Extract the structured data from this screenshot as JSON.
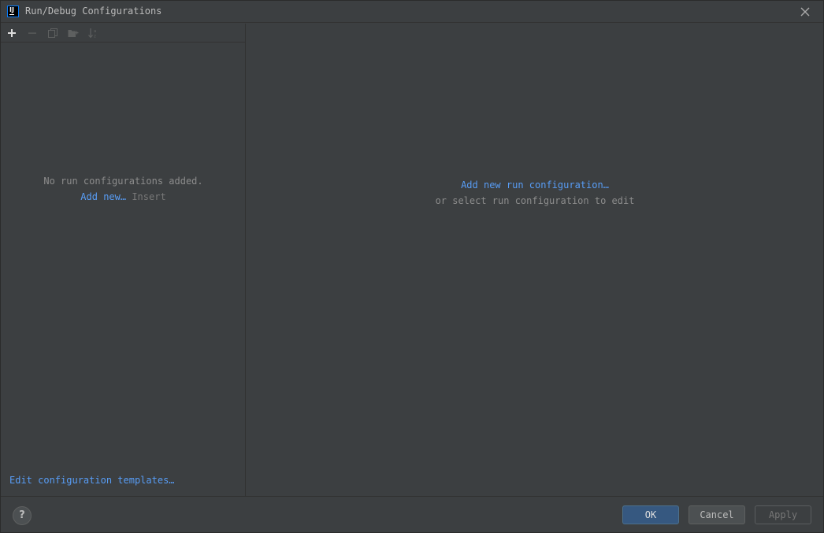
{
  "window": {
    "title": "Run/Debug Configurations",
    "app_icon_text": "IJ"
  },
  "toolbar": {
    "icons": [
      "add-icon",
      "remove-icon",
      "copy-icon",
      "folder-icon",
      "sort-icon"
    ]
  },
  "left_panel": {
    "empty_message": "No run configurations added.",
    "add_new_label": "Add new…",
    "insert_hint": "Insert",
    "templates_link": "Edit configuration templates…"
  },
  "right_panel": {
    "add_link": "Add new run configuration…",
    "subtitle": "or select run configuration to edit"
  },
  "footer": {
    "help_label": "?",
    "ok_label": "OK",
    "cancel_label": "Cancel",
    "apply_label": "Apply"
  },
  "colors": {
    "background": "#3c3f41",
    "link": "#589df6",
    "primary_button": "#365880"
  }
}
